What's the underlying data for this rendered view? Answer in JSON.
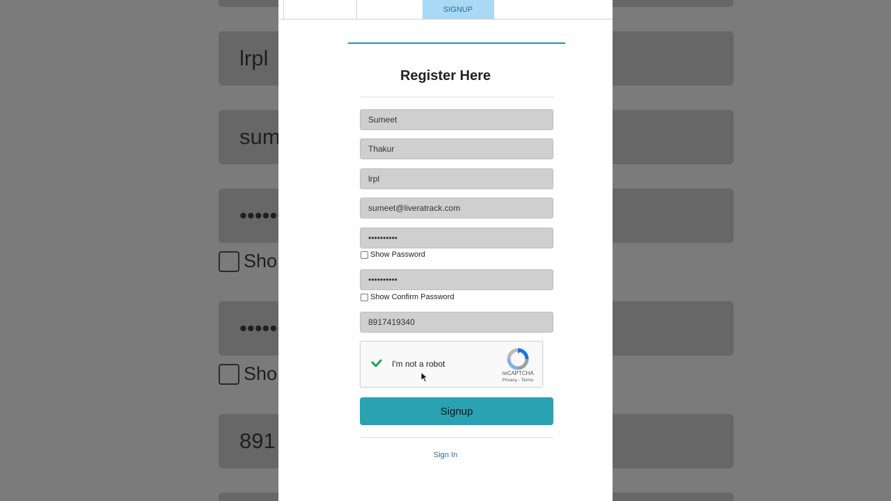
{
  "background": {
    "fields": [
      "lrpl",
      "sume",
      "••••••",
      "••••••",
      "891"
    ],
    "checks": [
      "Sho",
      "Sho"
    ]
  },
  "tabs": {
    "items": [
      "",
      "",
      "SIGNUP"
    ],
    "active": "SIGNUP"
  },
  "form": {
    "title": "Register Here",
    "first_name": "Sumeet",
    "last_name": "Thakur",
    "company": "lrpl",
    "email": "sumeet@liveratrack.com",
    "password": "••••••••••",
    "show_password_label": "Show Password",
    "confirm_password": "••••••••••",
    "show_confirm_password_label": "Show Confirm Password",
    "phone": "8917419340",
    "submit_label": "Signup",
    "signin_label": "Sign In"
  },
  "recaptcha": {
    "label": "I'm not a robot",
    "brand": "reCAPTCHA",
    "privacy": "Privacy",
    "separator": "-",
    "terms": "Terms",
    "checked": true
  },
  "colors": {
    "accent": "#2a8fae",
    "button": "#2aa2b2",
    "link": "#2b6d9a",
    "tab_active": "#a9d9f5",
    "check_green": "#1e9e57"
  }
}
